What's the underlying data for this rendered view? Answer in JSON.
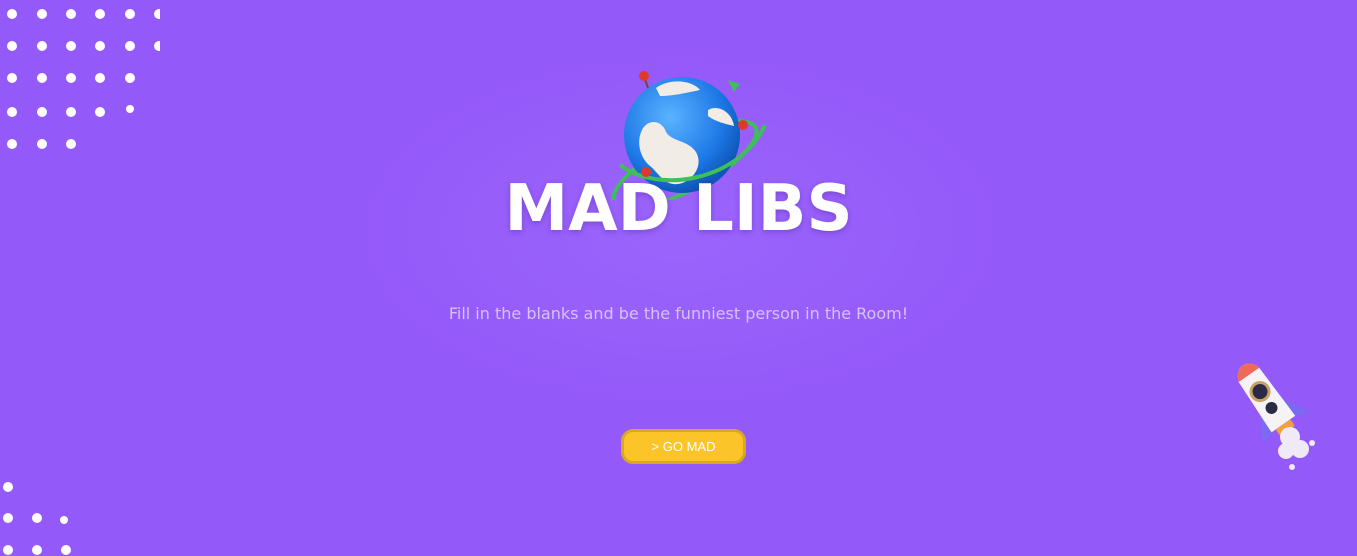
{
  "hero": {
    "title": "MAD LIBS",
    "subtitle": "Fill in the blanks and be the funniest person in the Room!",
    "cta_label": "> GO MAD"
  },
  "colors": {
    "background": "#9459f9",
    "button": "#fbc52a",
    "button_border": "#d9a820",
    "subtitle_text": "#d6c3f8"
  },
  "icons": {
    "hero_illustration": "globe-with-orbit-icon",
    "corner_illustration": "rocket-icon",
    "decoration": "dot-pattern"
  }
}
